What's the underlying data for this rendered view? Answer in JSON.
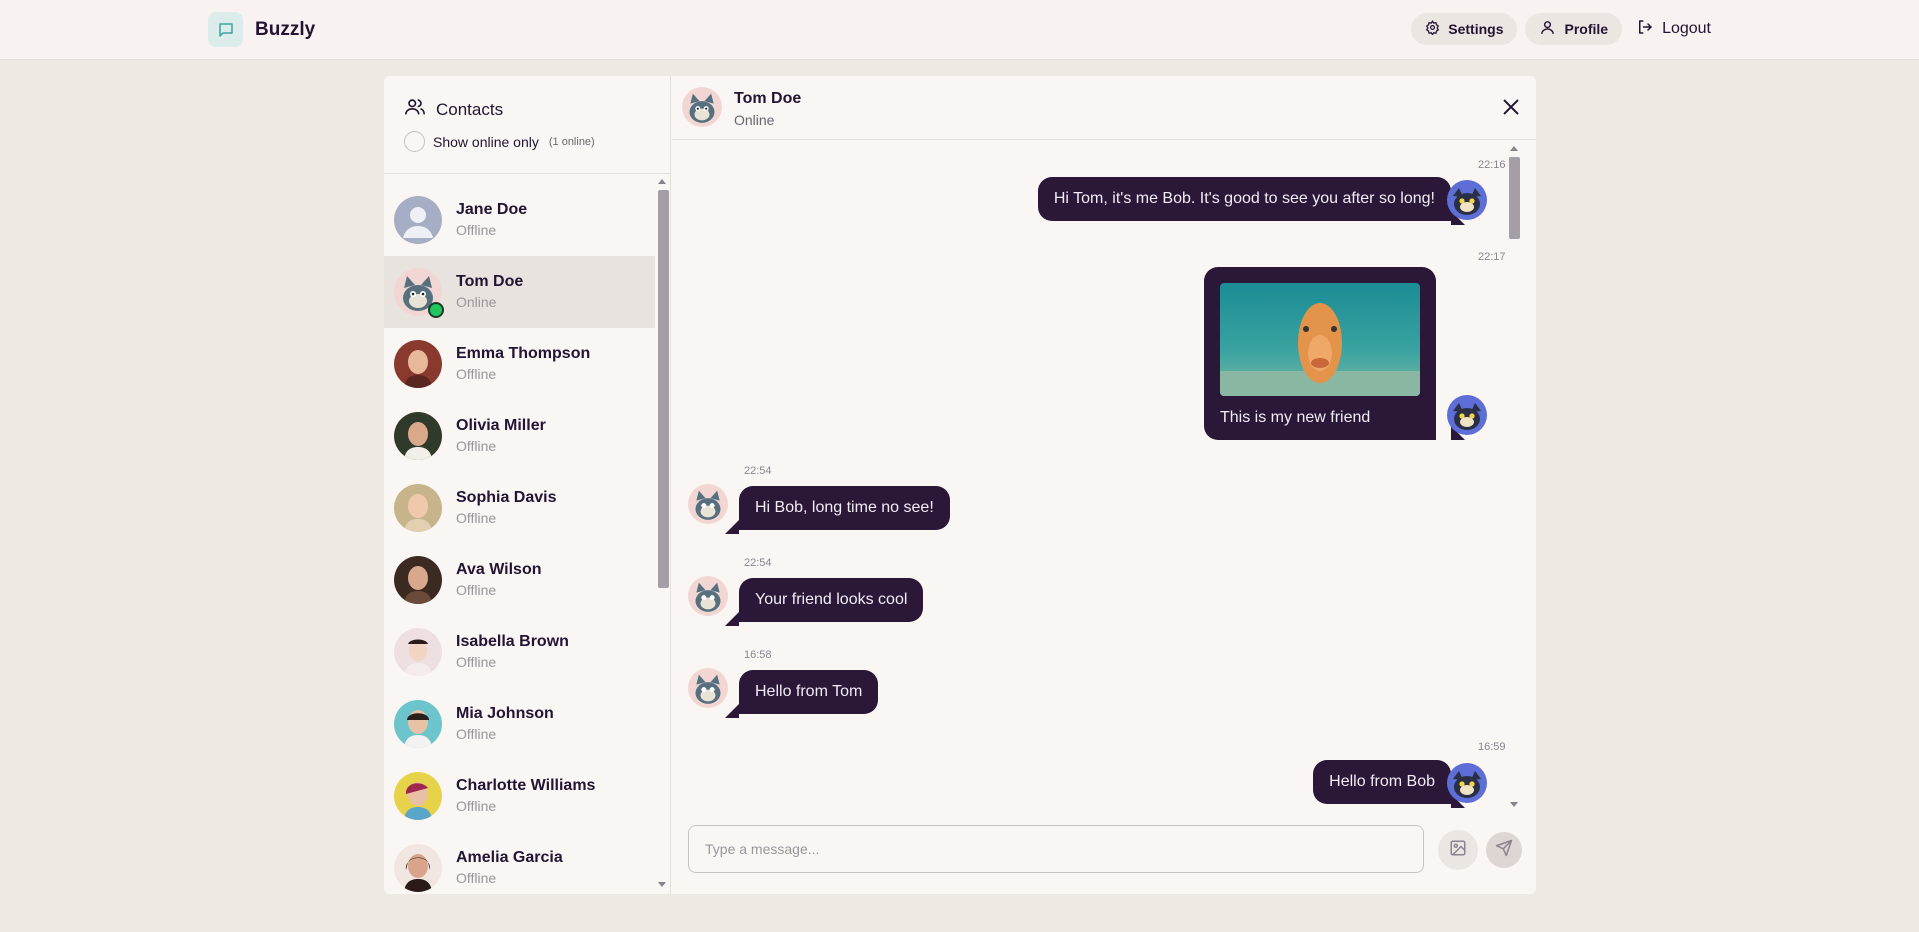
{
  "app": {
    "name": "Buzzly",
    "icon": "chat-bubble-icon"
  },
  "nav": {
    "settings_label": "Settings",
    "profile_label": "Profile",
    "logout_label": "Logout"
  },
  "sidebar": {
    "title": "Contacts",
    "filter_label": "Show online only",
    "online_count": "(1 online)",
    "contacts": [
      {
        "name": "Jane Doe",
        "status": "Offline"
      },
      {
        "name": "Tom Doe",
        "status": "Online",
        "active": true
      },
      {
        "name": "Emma Thompson",
        "status": "Offline"
      },
      {
        "name": "Olivia Miller",
        "status": "Offline"
      },
      {
        "name": "Sophia Davis",
        "status": "Offline"
      },
      {
        "name": "Ava Wilson",
        "status": "Offline"
      },
      {
        "name": "Isabella Brown",
        "status": "Offline"
      },
      {
        "name": "Mia Johnson",
        "status": "Offline"
      },
      {
        "name": "Charlotte Williams",
        "status": "Offline"
      },
      {
        "name": "Amelia Garcia",
        "status": "Offline"
      }
    ]
  },
  "chat": {
    "contact_name": "Tom Doe",
    "contact_status": "Online",
    "messages": [
      {
        "time": "22:16",
        "text": "Hi Tom, it's me Bob. It's good to see you after so long!",
        "from": "me"
      },
      {
        "time": "22:17",
        "text": "This is my new friend",
        "from": "me",
        "has_image": true
      },
      {
        "time": "22:54",
        "text": "Hi Bob, long time no see!",
        "from": "them"
      },
      {
        "time": "22:54",
        "text": "Your friend looks cool",
        "from": "them"
      },
      {
        "time": "16:58",
        "text": "Hello from Tom",
        "from": "them"
      },
      {
        "time": "16:59",
        "text": "Hello from Bob",
        "from": "me"
      }
    ],
    "input_placeholder": "Type a message..."
  },
  "colors": {
    "accent": "#2b1738",
    "background": "#efe9e4",
    "online": "#22c55e"
  }
}
